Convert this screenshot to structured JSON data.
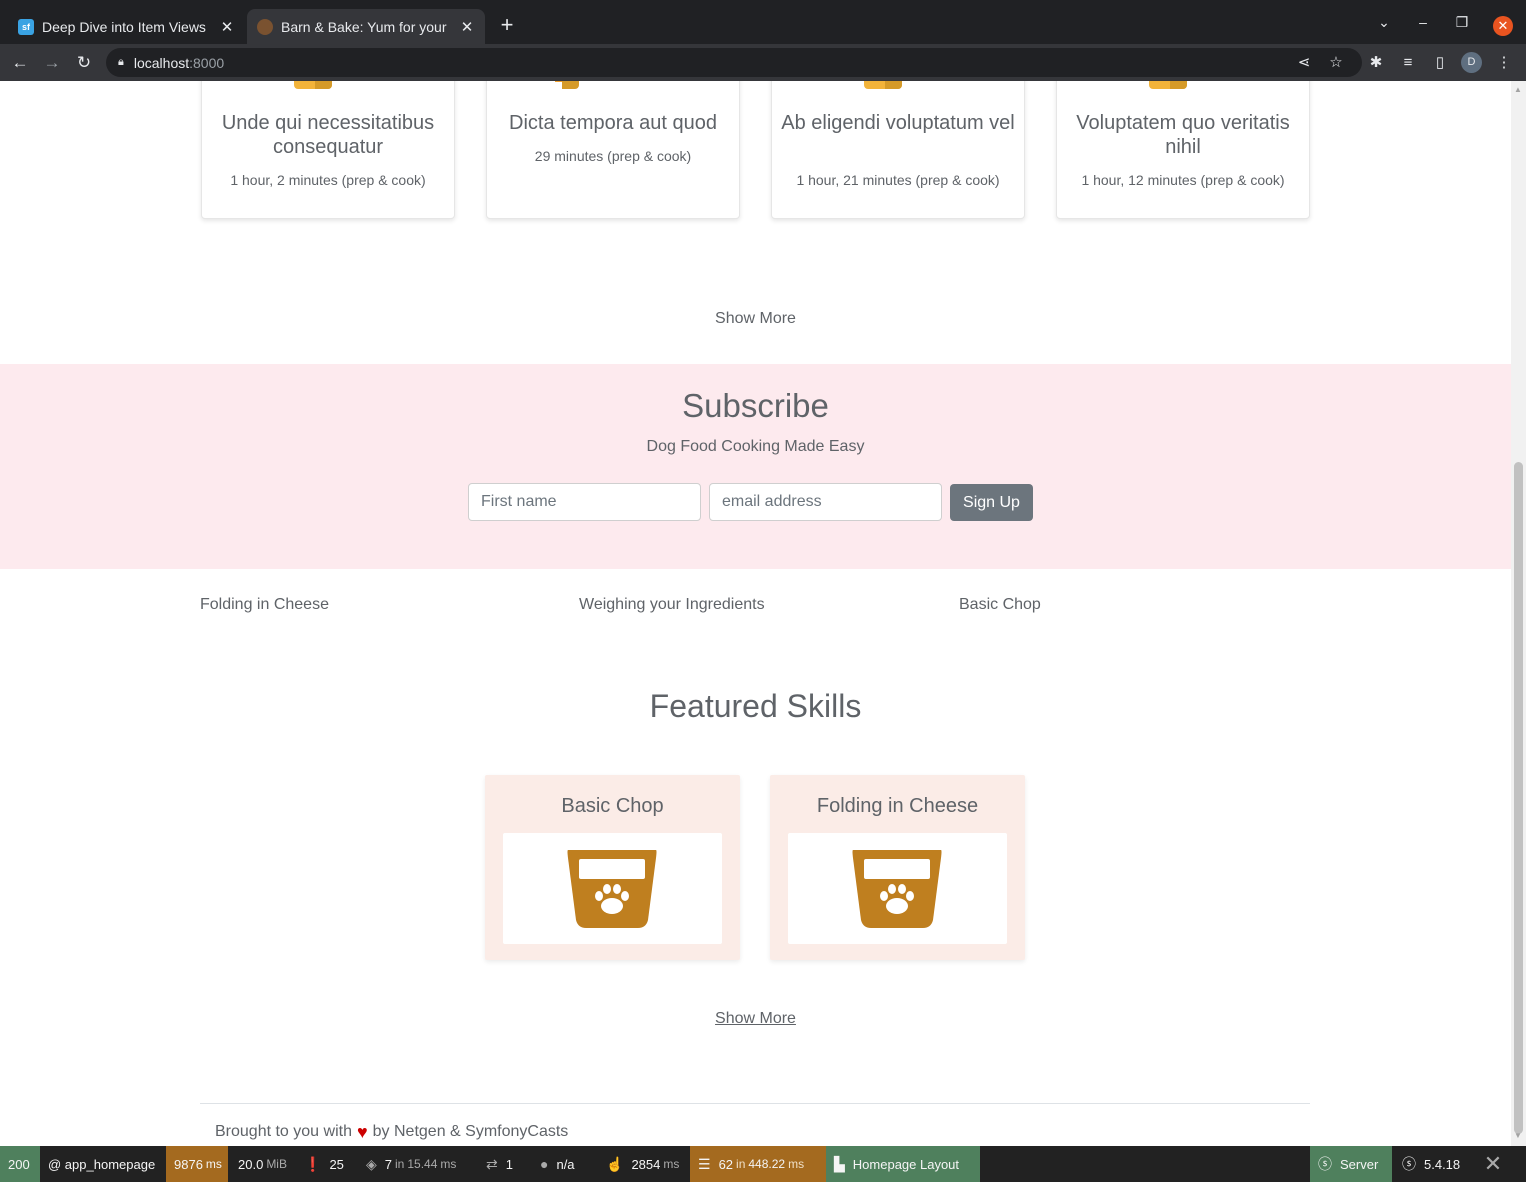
{
  "browser": {
    "tabs": [
      {
        "title": "Deep Dive into Item Views",
        "favicon": "symfonycasts-favicon-icon",
        "active": false
      },
      {
        "title": "Barn & Bake: Yum for your",
        "favicon": "barn-and-bake-favicon-icon",
        "active": true
      }
    ],
    "address": {
      "host": "localhost",
      "port": ":8000"
    },
    "profile_initial": "D"
  },
  "recipes": [
    {
      "title": "Unde qui necessitatibus consequatur",
      "time": "1 hour, 2 minutes (prep & cook)"
    },
    {
      "title": "Dicta tempora aut quod",
      "time": "29 minutes (prep & cook)"
    },
    {
      "title": "Ab eligendi voluptatum vel",
      "time": "1 hour, 21 minutes (prep & cook)"
    },
    {
      "title": "Voluptatem quo veritatis nihil",
      "time": "1 hour, 12 minutes (prep & cook)"
    }
  ],
  "recipes_show_more": "Show More",
  "subscribe": {
    "title": "Subscribe",
    "subtitle": "Dog Food Cooking Made Easy",
    "first_name_placeholder": "First name",
    "email_placeholder": "email address",
    "button": "Sign Up"
  },
  "skill_links": [
    "Folding in Cheese",
    "Weighing your Ingredients",
    "Basic Chop"
  ],
  "featured": {
    "title": "Featured Skills",
    "cards": [
      {
        "title": "Basic Chop",
        "icon": "dog-bowl-icon"
      },
      {
        "title": "Folding in Cheese",
        "icon": "dog-bowl-icon"
      }
    ],
    "show_more": "Show More"
  },
  "footer": {
    "before": "Brought to you with",
    "after": "by Netgen & SymfonyCasts"
  },
  "profiler": {
    "status": "200",
    "route": "@ app_homepage",
    "time_value": "9876",
    "time_unit": "ms",
    "memory_value": "20.0",
    "memory_unit": "MiB",
    "logs": "25",
    "cache_value": "7",
    "cache_in": "in",
    "cache_time": "15.44",
    "cache_unit": "ms",
    "translations": "1",
    "user": "n/a",
    "ajax_value": "2854",
    "ajax_unit": "ms",
    "db_value": "62",
    "db_in": "in",
    "db_time": "448.22",
    "db_unit": "ms",
    "layout": "Homepage Layout",
    "server": "Server",
    "version": "5.4.18"
  },
  "colors": {
    "subscribe_bg": "#fdeaee",
    "skill_card_bg": "#fbece7",
    "bowl": "#bf7f1f",
    "profiler_green": "#4f805d",
    "profiler_amber": "#a46a1f"
  }
}
